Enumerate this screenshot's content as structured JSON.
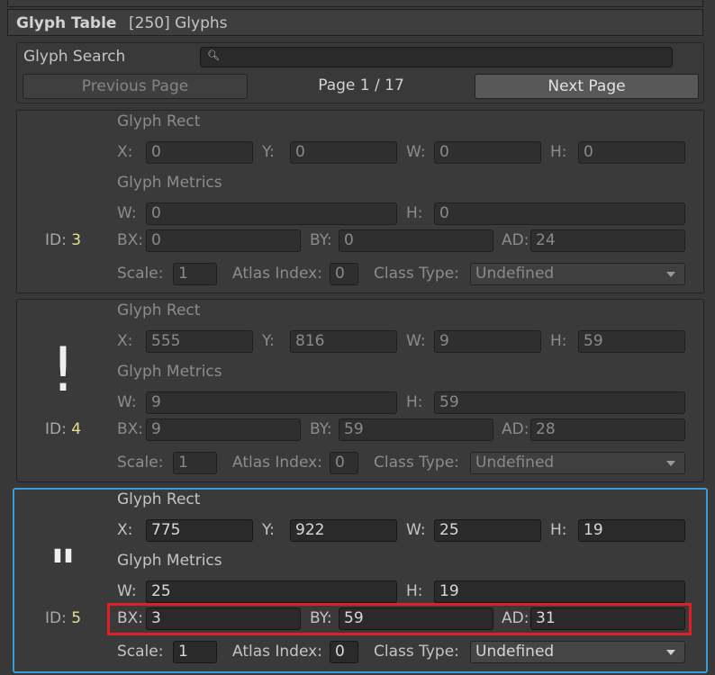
{
  "header": {
    "title": "Glyph Table",
    "count": "[250] Glyphs"
  },
  "search": {
    "label": "Glyph Search",
    "value": "",
    "icon": "search-icon"
  },
  "pagination": {
    "prev_label": "Previous Page",
    "page_label": "Page 1 / 17",
    "next_label": "Next Page"
  },
  "labels": {
    "glyph_rect": "Glyph Rect",
    "glyph_metrics": "Glyph Metrics",
    "x": "X:",
    "y": "Y:",
    "w": "W:",
    "h": "H:",
    "bx": "BX:",
    "by": "BY:",
    "ad": "AD:",
    "scale": "Scale:",
    "atlas_index": "Atlas Index:",
    "class_type": "Class Type:",
    "id": "ID:"
  },
  "glyphs": [
    {
      "id": "3",
      "preview": "",
      "rect": {
        "x": "0",
        "y": "0",
        "w": "0",
        "h": "0"
      },
      "metrics": {
        "w": "0",
        "h": "0",
        "bx": "0",
        "by": "0",
        "ad": "24"
      },
      "scale": "1",
      "atlas_index": "0",
      "class_type": "Undefined"
    },
    {
      "id": "4",
      "preview": "!",
      "rect": {
        "x": "555",
        "y": "816",
        "w": "9",
        "h": "59"
      },
      "metrics": {
        "w": "9",
        "h": "59",
        "bx": "9",
        "by": "59",
        "ad": "28"
      },
      "scale": "1",
      "atlas_index": "0",
      "class_type": "Undefined"
    },
    {
      "id": "5",
      "preview": "\"",
      "rect": {
        "x": "775",
        "y": "922",
        "w": "25",
        "h": "19"
      },
      "metrics": {
        "w": "25",
        "h": "19",
        "bx": "3",
        "by": "59",
        "ad": "31"
      },
      "scale": "1",
      "atlas_index": "0",
      "class_type": "Undefined"
    }
  ],
  "colors": {
    "selection": "#3c9ad8",
    "highlight": "#e01e25",
    "id_value": "#e6e08c"
  }
}
